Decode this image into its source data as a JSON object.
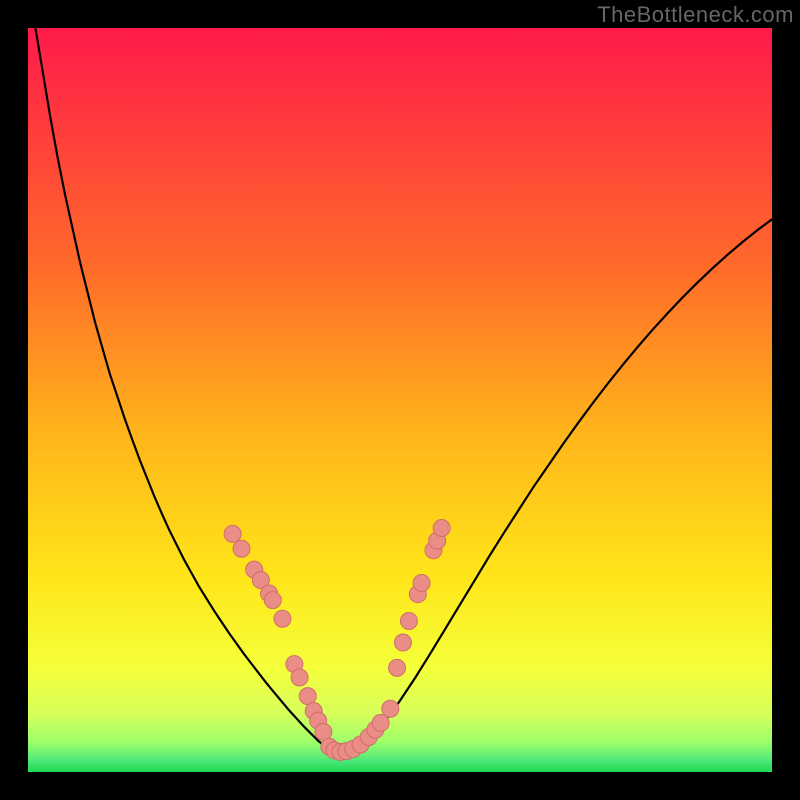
{
  "watermark": "TheBottleneck.com",
  "colors": {
    "black": "#000000",
    "curve": "#000000",
    "marker_fill": "#e98d86",
    "marker_stroke": "#cf6f68",
    "grad_top": "#ff1a4a",
    "grad_mid1": "#ff8a2a",
    "grad_mid2": "#ffd21a",
    "grad_band1": "#f5ff3a",
    "grad_band2": "#d8ff5a",
    "grad_band3": "#9cff6a",
    "grad_bottom": "#1dd94f"
  },
  "chart_data": {
    "type": "line",
    "title": "",
    "xlabel": "",
    "ylabel": "",
    "xlim": [
      0,
      100
    ],
    "ylim": [
      0,
      100
    ],
    "curve": {
      "x": [
        0,
        1,
        2,
        3,
        4,
        5,
        6,
        7,
        8,
        9,
        10,
        11,
        12,
        13,
        14,
        15,
        16,
        17,
        18,
        19,
        20,
        21,
        22,
        23,
        24,
        25,
        26,
        27,
        28,
        29,
        30,
        31,
        32,
        33,
        34,
        35,
        36,
        37,
        38,
        38.5,
        39,
        39.5,
        40,
        40.5,
        41,
        41.5,
        42,
        42.5,
        43,
        44,
        45,
        46,
        47,
        48,
        49,
        50,
        52,
        54,
        56,
        58,
        60,
        62,
        64,
        66,
        68,
        70,
        72,
        74,
        76,
        78,
        80,
        82,
        84,
        86,
        88,
        90,
        92,
        94,
        96,
        98,
        100
      ],
      "y": [
        110,
        100,
        94,
        88,
        82.5,
        77.5,
        73,
        68.5,
        64.5,
        60.5,
        57,
        53.5,
        50.5,
        47.5,
        44.7,
        42,
        39.5,
        37,
        34.7,
        32.5,
        30.5,
        28.5,
        26.7,
        24.9,
        23.3,
        21.7,
        20.2,
        18.7,
        17.3,
        15.9,
        14.6,
        13.3,
        12,
        10.8,
        9.6,
        8.4,
        7.3,
        6.2,
        5.2,
        4.7,
        4.2,
        3.8,
        3.4,
        3.1,
        2.9,
        2.8,
        2.7,
        2.75,
        2.9,
        3.3,
        3.9,
        4.7,
        5.7,
        6.9,
        8.2,
        9.6,
        12.6,
        15.8,
        19.1,
        22.4,
        25.7,
        29,
        32.2,
        35.3,
        38.4,
        41.3,
        44.2,
        47,
        49.7,
        52.3,
        54.8,
        57.2,
        59.5,
        61.7,
        63.8,
        65.8,
        67.7,
        69.5,
        71.2,
        72.8,
        74.3
      ]
    },
    "markers": [
      {
        "x": 27.5,
        "y": 32.0
      },
      {
        "x": 28.7,
        "y": 30.0
      },
      {
        "x": 30.4,
        "y": 27.2
      },
      {
        "x": 31.3,
        "y": 25.8
      },
      {
        "x": 32.4,
        "y": 24.0
      },
      {
        "x": 32.9,
        "y": 23.1
      },
      {
        "x": 34.2,
        "y": 20.6
      },
      {
        "x": 35.8,
        "y": 14.5
      },
      {
        "x": 36.5,
        "y": 12.7
      },
      {
        "x": 37.6,
        "y": 10.2
      },
      {
        "x": 38.4,
        "y": 8.2
      },
      {
        "x": 39.0,
        "y": 6.9
      },
      {
        "x": 39.7,
        "y": 5.4
      },
      {
        "x": 40.5,
        "y": 3.4
      },
      {
        "x": 41.2,
        "y": 2.9
      },
      {
        "x": 42.0,
        "y": 2.7
      },
      {
        "x": 42.8,
        "y": 2.8
      },
      {
        "x": 43.7,
        "y": 3.1
      },
      {
        "x": 44.7,
        "y": 3.7
      },
      {
        "x": 45.8,
        "y": 4.7
      },
      {
        "x": 46.7,
        "y": 5.7
      },
      {
        "x": 47.4,
        "y": 6.6
      },
      {
        "x": 48.7,
        "y": 8.5
      },
      {
        "x": 49.6,
        "y": 14.0
      },
      {
        "x": 50.4,
        "y": 17.4
      },
      {
        "x": 51.2,
        "y": 20.3
      },
      {
        "x": 52.4,
        "y": 23.9
      },
      {
        "x": 52.9,
        "y": 25.4
      },
      {
        "x": 54.5,
        "y": 29.8
      },
      {
        "x": 55.0,
        "y": 31.1
      },
      {
        "x": 55.6,
        "y": 32.8
      }
    ]
  }
}
